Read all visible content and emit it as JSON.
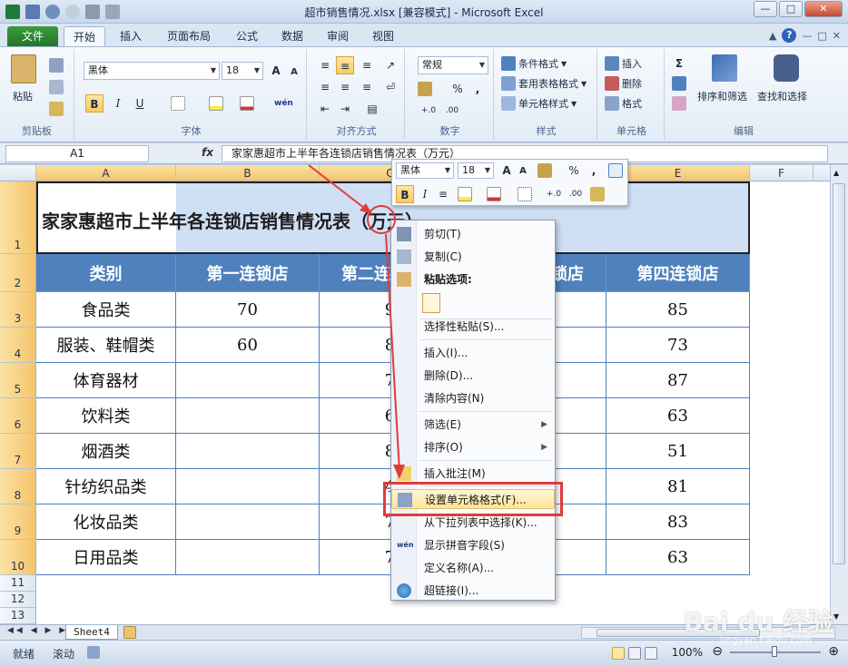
{
  "window": {
    "title": "超市销售情况.xlsx  [兼容模式]  -  Microsoft Excel",
    "min": "—",
    "max": "□",
    "close": "✕"
  },
  "tabs": [
    "文件",
    "开始",
    "插入",
    "页面布局",
    "公式",
    "数据",
    "审阅",
    "视图"
  ],
  "ribbon": {
    "clipboard": {
      "paste": "粘贴",
      "label": "剪贴板"
    },
    "font": {
      "name": "黑体",
      "size": "18",
      "bold": "B",
      "italic": "I",
      "underline": "U",
      "label": "字体",
      "grow": "A",
      "shrink": "A",
      "wen": "wén"
    },
    "alignment": {
      "label": "对齐方式"
    },
    "number": {
      "format": "常规",
      "label": "数字",
      "percent": "%",
      "comma": ","
    },
    "styles": {
      "conditional": "条件格式",
      "table": "套用表格格式",
      "cell": "单元格样式",
      "label": "样式"
    },
    "cells": {
      "insert": "插入",
      "delete": "删除",
      "format": "格式",
      "label": "单元格"
    },
    "editing": {
      "sum": "Σ",
      "sort": "排序和筛选",
      "find": "查找和选择",
      "label": "编辑"
    }
  },
  "formula_bar": {
    "name_box": "A1",
    "fx": "fx",
    "value": "家家惠超市上半年各连锁店销售情况表（万元）"
  },
  "columns": [
    "A",
    "B",
    "C",
    "D",
    "E",
    "F"
  ],
  "rows": [
    "1",
    "2",
    "3",
    "4",
    "5",
    "6",
    "7",
    "8",
    "9",
    "10",
    "11",
    "12",
    "13"
  ],
  "sheet": {
    "title": "家家惠超市上半年各连锁店销售情况表（万元）",
    "headers": [
      "类别",
      "第一连锁店",
      "第二连",
      "锁店",
      "第四连锁店"
    ],
    "categories": [
      "食品类",
      "服装、鞋帽类",
      "体育器材",
      "饮料类",
      "烟酒类",
      "针纺织品类",
      "化妆品类",
      "日用品类"
    ],
    "col_b": [
      "70",
      "60",
      "",
      "",
      "",
      "",
      "",
      ""
    ],
    "col_c": [
      "9",
      "8",
      "7",
      "6",
      "8",
      "4",
      "7",
      "7"
    ],
    "col_e": [
      "85",
      "73",
      "87",
      "63",
      "51",
      "81",
      "83",
      "63"
    ]
  },
  "mini_toolbar": {
    "font": "黑体",
    "size": "18",
    "percent": "%",
    "comma": ",",
    "bold": "B",
    "italic": "I"
  },
  "context_menu": {
    "cut": "剪切(T)",
    "copy": "复制(C)",
    "paste_options": "粘贴选项:",
    "paste_special": "选择性粘贴(S)...",
    "insert": "插入(I)...",
    "delete": "删除(D)...",
    "clear": "清除内容(N)",
    "filter": "筛选(E)",
    "sort": "排序(O)",
    "comment": "插入批注(M)",
    "format_cells": "设置单元格格式(F)...",
    "pick_list": "从下拉列表中选择(K)...",
    "phonetic": "显示拼音字段(S)",
    "define_name": "定义名称(A)...",
    "hyperlink": "超链接(I)...",
    "wen": "wén"
  },
  "sheet_tab": "Sheet4",
  "status": {
    "ready": "就绪",
    "scroll": "滚动",
    "zoom": "100%"
  },
  "watermark": {
    "brand": "Bai du 经验",
    "url": "jingyan.baidu.com"
  },
  "colors": {
    "header_fill": "#4f81bd",
    "highlight": "#ffe49a",
    "annotation": "#e23b3b",
    "file_tab": "#2f8a34"
  }
}
